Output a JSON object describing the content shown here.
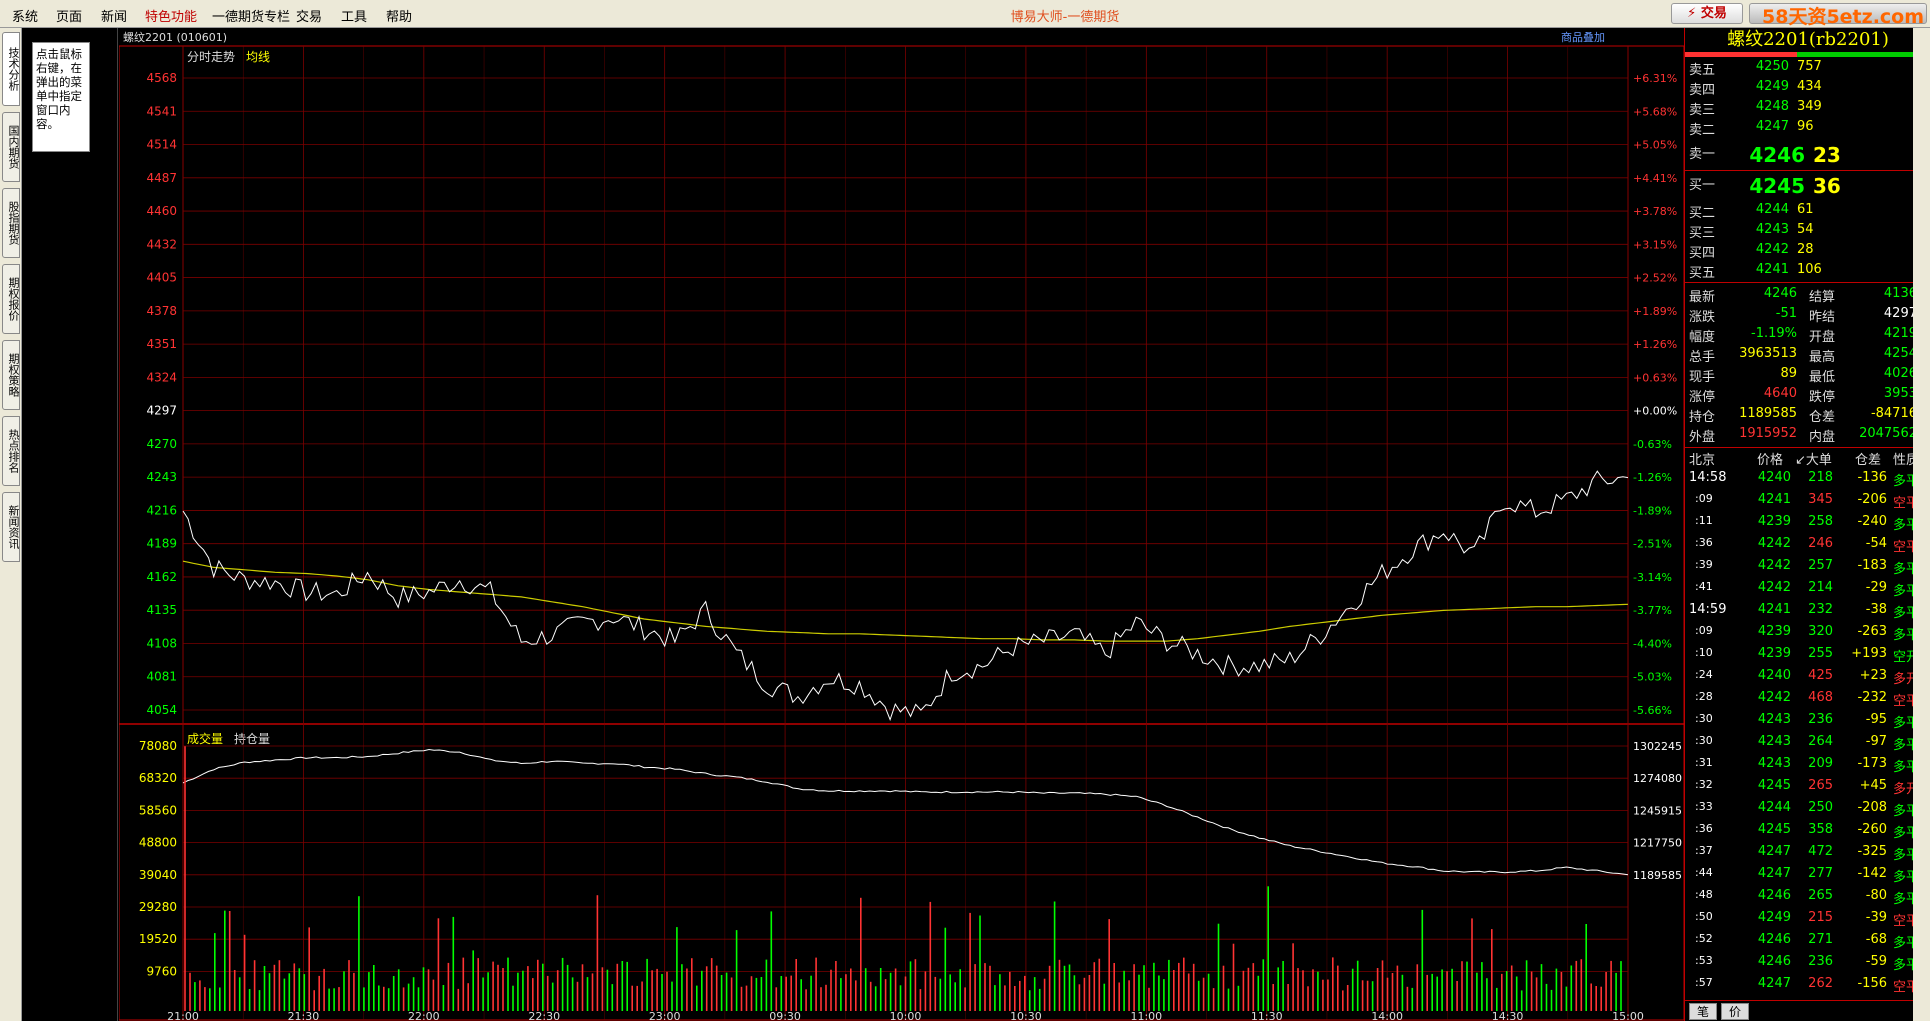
{
  "menubar": {
    "items": [
      "系统",
      "页面",
      "新闻",
      "特色功能",
      "一德期货专栏",
      "交易",
      "工具",
      "帮助"
    ],
    "special_index": 3,
    "title": "博易大师-一德期货",
    "trade_button": "交易",
    "watermark": "58天资5etz.com"
  },
  "left_tabs": [
    "技术分析",
    "国内期货",
    "股指期货",
    "期权报价",
    "期权策略",
    "热点排名",
    "新闻资讯"
  ],
  "tip_text": "点击鼠标右键，在弹出的菜单中指定窗口内容。",
  "chart": {
    "symbol_header": "螺纹2201 (010601)",
    "price_panel_label": "分时走势",
    "avg_label": "均线",
    "overlay_button": "商品叠加",
    "volume_label": "成交量",
    "oi_label": "持仓量",
    "price_left_ticks": [
      "4568",
      "4541",
      "4514",
      "4487",
      "4460",
      "4432",
      "4405",
      "4378",
      "4351",
      "4324",
      "4297",
      "4270",
      "4243",
      "4216",
      "4189",
      "4162",
      "4135",
      "4108",
      "4081",
      "4054"
    ],
    "price_right_ticks": [
      "+6.31%",
      "+5.68%",
      "+5.05%",
      "+4.41%",
      "+3.78%",
      "+3.15%",
      "+2.52%",
      "+1.89%",
      "+1.26%",
      "+0.63%",
      "+0.00%",
      "-0.63%",
      "-1.26%",
      "-1.89%",
      "-2.51%",
      "-3.14%",
      "-3.77%",
      "-4.40%",
      "-5.03%",
      "-5.66%"
    ],
    "vol_left_ticks": [
      "78080",
      "68320",
      "58560",
      "48800",
      "39040",
      "29280",
      "19520",
      "9760"
    ],
    "oi_right_ticks": [
      "1302245",
      "1274080",
      "1245915",
      "1217750",
      "1189585"
    ],
    "time_ticks": [
      "21:00",
      "21:30",
      "22:00",
      "22:30",
      "23:00",
      "09:30",
      "10:00",
      "10:30",
      "11:00",
      "11:30",
      "14:00",
      "14:30",
      "15:00"
    ],
    "colors": {
      "grid": "#7a0000",
      "up": "#ff3333",
      "down": "#00ff00",
      "price_line": "#ffffff",
      "avg_line": "#cccc00"
    }
  },
  "chart_data": {
    "type": "line",
    "title": "螺纹2201 (010601)",
    "prev_settle": 4297,
    "ylim": [
      4040,
      4580
    ],
    "x_categories": [
      "21:00",
      "21:30",
      "22:00",
      "22:30",
      "23:00",
      "09:30",
      "10:00",
      "10:30",
      "11:00",
      "11:30",
      "14:00",
      "14:30",
      "15:00"
    ],
    "series": [
      {
        "name": "分时走势",
        "values": [
          4216,
          4170,
          4160,
          4158,
          4150,
          4148,
          4165,
          4145,
          4150,
          4160,
          4150,
          4110,
          4115,
          4125,
          4130,
          4120,
          4110,
          4135,
          4100,
          4075,
          4065,
          4080,
          4075,
          4055,
          4050,
          4085,
          4090,
          4105,
          4110,
          4115,
          4100,
          4125,
          4110,
          4100,
          4090,
          4090,
          4095,
          4115,
          4140,
          4165,
          4185,
          4200,
          4180,
          4225,
          4215,
          4225,
          4240,
          4243
        ]
      },
      {
        "name": "均线",
        "values": [
          4175,
          4170,
          4168,
          4166,
          4165,
          4163,
          4160,
          4155,
          4152,
          4150,
          4148,
          4146,
          4142,
          4138,
          4133,
          4128,
          4125,
          4122,
          4120,
          4118,
          4117,
          4116,
          4116,
          4115,
          4114,
          4113,
          4112,
          4112,
          4111,
          4111,
          4110,
          4110,
          4110,
          4112,
          4115,
          4118,
          4122,
          4125,
          4128,
          4131,
          4133,
          4135,
          4136,
          4137,
          4138,
          4138,
          4139,
          4140
        ]
      },
      {
        "name": "持仓量",
        "values": [
          1270000,
          1282000,
          1288000,
          1290000,
          1292000,
          1292000,
          1293000,
          1296000,
          1299000,
          1297000,
          1290000,
          1287000,
          1289000,
          1287000,
          1287000,
          1284000,
          1282000,
          1278000,
          1275000,
          1271000,
          1265000,
          1263000,
          1263000,
          1263000,
          1262000,
          1262000,
          1262000,
          1262000,
          1261000,
          1261000,
          1260000,
          1258000,
          1250000,
          1240000,
          1230000,
          1222000,
          1215000,
          1210000,
          1205000,
          1200000,
          1197000,
          1193000,
          1192000,
          1192000,
          1193000,
          1196000,
          1193000,
          1189585
        ]
      }
    ],
    "volume_ylim": [
      0,
      85000
    ]
  },
  "quote": {
    "title": "螺纹2201(rb2201)",
    "asks": [
      {
        "label": "卖五",
        "price": "4250",
        "vol": "757"
      },
      {
        "label": "卖四",
        "price": "4249",
        "vol": "434"
      },
      {
        "label": "卖三",
        "price": "4248",
        "vol": "349"
      },
      {
        "label": "卖二",
        "price": "4247",
        "vol": "96"
      },
      {
        "label": "卖一",
        "price": "4246",
        "vol": "23"
      }
    ],
    "bids": [
      {
        "label": "买一",
        "price": "4245",
        "vol": "36"
      },
      {
        "label": "买二",
        "price": "4244",
        "vol": "61"
      },
      {
        "label": "买三",
        "price": "4243",
        "vol": "54"
      },
      {
        "label": "买四",
        "price": "4242",
        "vol": "28"
      },
      {
        "label": "买五",
        "price": "4241",
        "vol": "106"
      }
    ],
    "stats": [
      {
        "l1": "最新",
        "v1": "4246",
        "c1": "green",
        "l2": "结算",
        "v2": "4136",
        "c2": "green"
      },
      {
        "l1": "涨跌",
        "v1": "-51",
        "c1": "green",
        "l2": "昨结",
        "v2": "4297",
        "c2": "white"
      },
      {
        "l1": "幅度",
        "v1": "-1.19%",
        "c1": "green",
        "l2": "开盘",
        "v2": "4219",
        "c2": "green"
      },
      {
        "l1": "总手",
        "v1": "3963513",
        "c1": "yellow",
        "l2": "最高",
        "v2": "4254",
        "c2": "green"
      },
      {
        "l1": "现手",
        "v1": "89",
        "c1": "yellow",
        "l2": "最低",
        "v2": "4026",
        "c2": "green"
      },
      {
        "l1": "涨停",
        "v1": "4640",
        "c1": "red",
        "l2": "跌停",
        "v2": "3953",
        "c2": "green"
      },
      {
        "l1": "持仓",
        "v1": "1189585",
        "c1": "yellow",
        "l2": "仓差",
        "v2": "-84716",
        "c2": "yellow"
      },
      {
        "l1": "外盘",
        "v1": "1915952",
        "c1": "red",
        "l2": "内盘",
        "v2": "2047562",
        "c2": "green"
      }
    ],
    "tick_header": [
      "北京",
      "价格",
      "↙大单",
      "仓差",
      "性质"
    ],
    "ticks": [
      {
        "t": "14:58",
        "p": "4240",
        "v": "218",
        "vc": "green",
        "d": "-136",
        "n": "多平",
        "nc": "green"
      },
      {
        "t": ":09",
        "p": "4241",
        "v": "345",
        "vc": "red",
        "d": "-206",
        "n": "空平",
        "nc": "red"
      },
      {
        "t": ":11",
        "p": "4239",
        "v": "258",
        "vc": "green",
        "d": "-240",
        "n": "多平",
        "nc": "green"
      },
      {
        "t": ":36",
        "p": "4242",
        "v": "246",
        "vc": "red",
        "d": "-54",
        "n": "空平",
        "nc": "red"
      },
      {
        "t": ":39",
        "p": "4242",
        "v": "257",
        "vc": "green",
        "d": "-183",
        "n": "多平",
        "nc": "green"
      },
      {
        "t": ":41",
        "p": "4242",
        "v": "214",
        "vc": "green",
        "d": "-29",
        "n": "多平",
        "nc": "green"
      },
      {
        "t": "14:59",
        "p": "4241",
        "v": "232",
        "vc": "green",
        "d": "-38",
        "n": "多平",
        "nc": "green"
      },
      {
        "t": ":09",
        "p": "4239",
        "v": "320",
        "vc": "green",
        "d": "-263",
        "n": "多平",
        "nc": "green"
      },
      {
        "t": ":10",
        "p": "4239",
        "v": "255",
        "vc": "green",
        "d": "+193",
        "n": "空开",
        "nc": "green"
      },
      {
        "t": ":24",
        "p": "4240",
        "v": "425",
        "vc": "red",
        "d": "+23",
        "n": "多开",
        "nc": "red"
      },
      {
        "t": ":28",
        "p": "4242",
        "v": "468",
        "vc": "red",
        "d": "-232",
        "n": "空平",
        "nc": "red"
      },
      {
        "t": ":30",
        "p": "4243",
        "v": "236",
        "vc": "green",
        "d": "-95",
        "n": "多平",
        "nc": "green"
      },
      {
        "t": ":30",
        "p": "4243",
        "v": "264",
        "vc": "green",
        "d": "-97",
        "n": "多平",
        "nc": "green"
      },
      {
        "t": ":31",
        "p": "4243",
        "v": "209",
        "vc": "green",
        "d": "-173",
        "n": "多平",
        "nc": "green"
      },
      {
        "t": ":32",
        "p": "4245",
        "v": "265",
        "vc": "red",
        "d": "+45",
        "n": "多开",
        "nc": "red"
      },
      {
        "t": ":33",
        "p": "4244",
        "v": "250",
        "vc": "green",
        "d": "-208",
        "n": "多平",
        "nc": "green"
      },
      {
        "t": ":36",
        "p": "4245",
        "v": "358",
        "vc": "green",
        "d": "-260",
        "n": "多平",
        "nc": "green"
      },
      {
        "t": ":37",
        "p": "4247",
        "v": "472",
        "vc": "green",
        "d": "-325",
        "n": "多平",
        "nc": "green"
      },
      {
        "t": ":44",
        "p": "4247",
        "v": "277",
        "vc": "green",
        "d": "-142",
        "n": "多平",
        "nc": "green"
      },
      {
        "t": ":48",
        "p": "4246",
        "v": "265",
        "vc": "green",
        "d": "-80",
        "n": "多平",
        "nc": "green"
      },
      {
        "t": ":50",
        "p": "4249",
        "v": "215",
        "vc": "red",
        "d": "-39",
        "n": "空平",
        "nc": "red"
      },
      {
        "t": ":52",
        "p": "4246",
        "v": "271",
        "vc": "green",
        "d": "-68",
        "n": "多平",
        "nc": "green"
      },
      {
        "t": ":53",
        "p": "4246",
        "v": "236",
        "vc": "green",
        "d": "-59",
        "n": "多平",
        "nc": "green"
      },
      {
        "t": ":57",
        "p": "4247",
        "v": "262",
        "vc": "red",
        "d": "-156",
        "n": "空平",
        "nc": "red"
      }
    ],
    "tick_tabs": [
      "笔",
      "价"
    ]
  }
}
